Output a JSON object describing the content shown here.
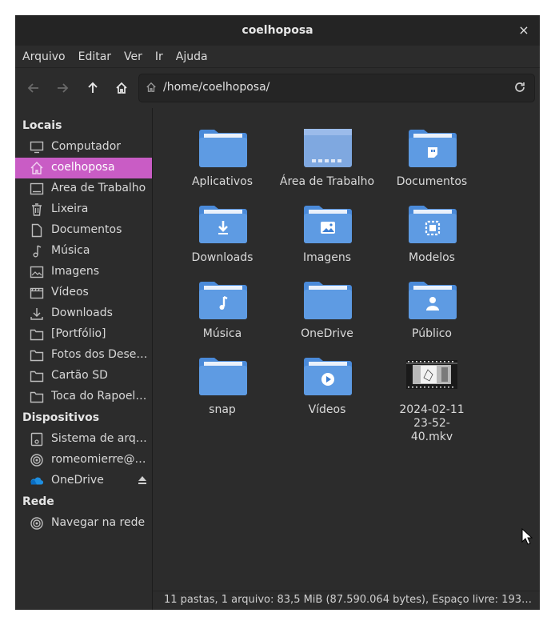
{
  "window": {
    "title": "coelhoposa",
    "close_glyph": "×"
  },
  "menu": [
    "Arquivo",
    "Editar",
    "Ver",
    "Ir",
    "Ajuda"
  ],
  "toolbar": {
    "path": "/home/coelhoposa/"
  },
  "sidebar": {
    "locais_header": "Locais",
    "locais": [
      {
        "label": "Computador",
        "icon": "computer-icon"
      },
      {
        "label": "coelhoposa",
        "icon": "home-icon",
        "active": true
      },
      {
        "label": "Área de Trabalho",
        "icon": "desktop-icon"
      },
      {
        "label": "Lixeira",
        "icon": "trash-icon"
      },
      {
        "label": "Documentos",
        "icon": "document-icon"
      },
      {
        "label": "Música",
        "icon": "music-icon"
      },
      {
        "label": "Imagens",
        "icon": "image-icon"
      },
      {
        "label": "Vídeos",
        "icon": "video-icon"
      },
      {
        "label": "Downloads",
        "icon": "download-icon"
      },
      {
        "label": "[Portfólio]",
        "icon": "folder-icon"
      },
      {
        "label": "Fotos dos Desenhos",
        "icon": "folder-icon"
      },
      {
        "label": "Cartão SD",
        "icon": "folder-icon"
      },
      {
        "label": "Toca do Rapoelho",
        "icon": "folder-icon"
      }
    ],
    "dispositivos_header": "Dispositivos",
    "dispositivos": [
      {
        "label": "Sistema de arquivos",
        "icon": "drive-icon"
      },
      {
        "label": "romeomierre@gmail.com",
        "icon": "network-icon"
      },
      {
        "label": "OneDrive",
        "icon": "onedrive-icon"
      }
    ],
    "rede_header": "Rede",
    "rede": [
      {
        "label": "Navegar na rede",
        "icon": "network-icon"
      }
    ]
  },
  "files": [
    {
      "label": "Aplicativos",
      "type": "folder"
    },
    {
      "label": "Área de Trabalho",
      "type": "desktop-folder"
    },
    {
      "label": "Documentos",
      "type": "documents-folder"
    },
    {
      "label": "Downloads",
      "type": "downloads-folder"
    },
    {
      "label": "Imagens",
      "type": "pictures-folder"
    },
    {
      "label": "Modelos",
      "type": "templates-folder"
    },
    {
      "label": "Música",
      "type": "music-folder"
    },
    {
      "label": "OneDrive",
      "type": "folder"
    },
    {
      "label": "Público",
      "type": "public-folder"
    },
    {
      "label": "snap",
      "type": "folder"
    },
    {
      "label": "Vídeos",
      "type": "videos-folder"
    },
    {
      "label": "2024-02-11 23-52-40.mkv",
      "type": "video-file"
    }
  ],
  "status": "11 pastas, 1 arquivo: 83,5 MiB (87.590.064 bytes), Espaço livre: 193…",
  "colors": {
    "folder": "#3d7fd3",
    "folder_light": "#5d9ae2",
    "active": "#c95cc5"
  }
}
